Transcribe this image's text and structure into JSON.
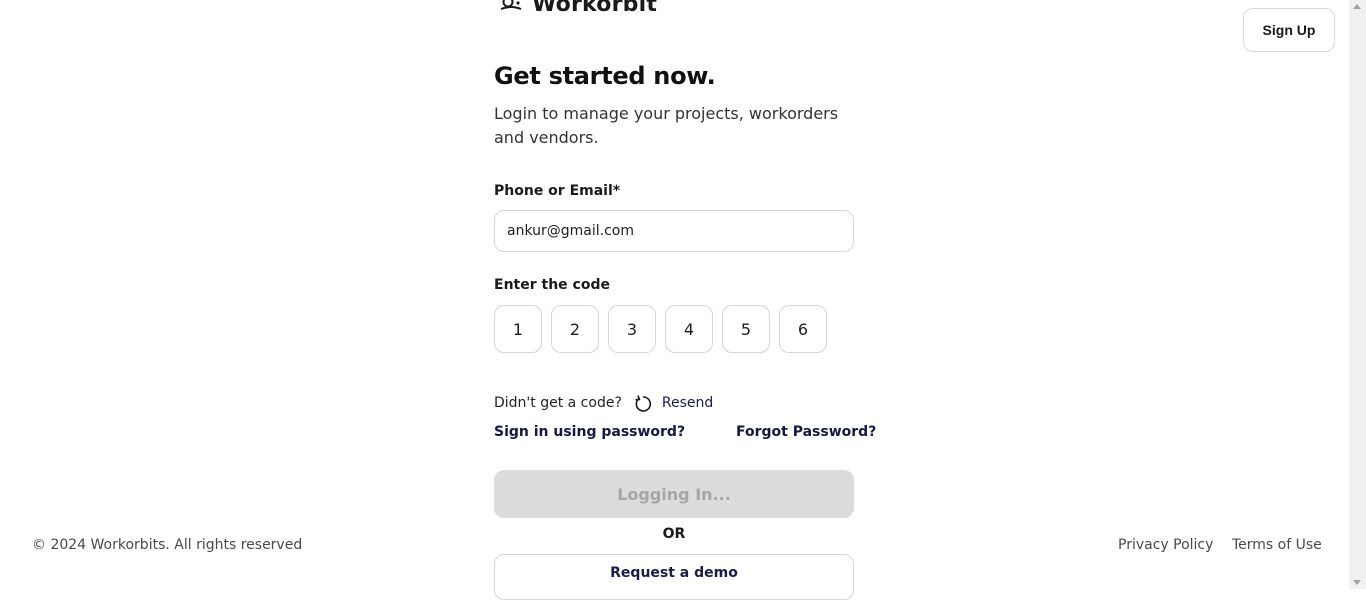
{
  "header": {
    "brand": "Workorbit",
    "signup_label": "Sign Up"
  },
  "form": {
    "title": "Get started now.",
    "subtitle": "Login to manage your projects, workorders and vendors.",
    "email_label": "Phone or Email*",
    "email_value": "ankur@gmail.com",
    "code_label": "Enter the code",
    "code_digits": [
      "1",
      "2",
      "3",
      "4",
      "5",
      "6"
    ],
    "resend_prompt": "Didn't get a code?",
    "resend_label": "Resend",
    "password_link": "Sign in using password?",
    "forgot_link": "Forgot Password?",
    "login_button": "Logging In...",
    "or_text": "OR",
    "demo_button": "Request a demo"
  },
  "footer": {
    "copyright": "© 2024 Workorbits. All rights reserved",
    "privacy": "Privacy Policy",
    "terms": "Terms of Use"
  },
  "colors": {
    "primary_link": "#171744",
    "disabled_button": "#dcdcdc",
    "border": "#d6d6d6"
  },
  "icons": [
    "workorbit-logo-icon",
    "resend-icon"
  ]
}
